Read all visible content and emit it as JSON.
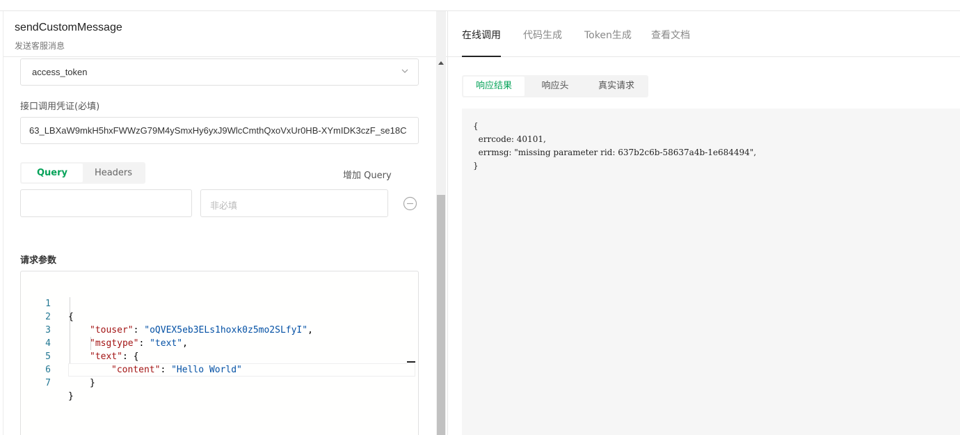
{
  "header": {
    "title": "sendCustomMessage",
    "subtitle": "发送客服消息"
  },
  "auth": {
    "select_value": "access_token",
    "token_label": "接口调用凭证(必填)",
    "token_value": "63_LBXaW9mkH5hxFWWzG79M4ySmxHy6yxJ9WlcCmthQxoVxUr0HB-XYmIDK3czF_se18C"
  },
  "params": {
    "tabs": [
      "Query",
      "Headers"
    ],
    "active_tab": "Query",
    "add_label": "增加 Query",
    "key_value": "",
    "value_placeholder": "非必填"
  },
  "body": {
    "label": "请求参数",
    "line_numbers": [
      "1",
      "2",
      "3",
      "4",
      "5",
      "6",
      "7"
    ],
    "code": {
      "l1": "{",
      "l2_key": "\"touser\"",
      "l2_val": "\"oQVEX5eb3ELs1hoxk0z5mo2SLfyI\"",
      "l3_key": "\"msgtype\"",
      "l3_val": "\"text\"",
      "l4_key": "\"text\"",
      "l4_brace": "{",
      "l5_key": "\"content\"",
      "l5_val": "\"Hello World\"",
      "l6": "}",
      "l7": "}"
    }
  },
  "right_tabs": {
    "items": [
      "在线调用",
      "代码生成",
      "Token生成",
      "查看文档"
    ],
    "active": "在线调用"
  },
  "response": {
    "tabs": [
      "响应结果",
      "响应头",
      "真实请求"
    ],
    "active": "响应结果",
    "lines": [
      "{",
      "  errcode: 40101,",
      "  errmsg: \"missing parameter rid: 637b2c6b-58637a4b-1e684494\",",
      "}"
    ]
  },
  "colors": {
    "accent": "#07a35a",
    "code_key": "#a31515",
    "code_string": "#0451a5",
    "line_number": "#237893"
  }
}
